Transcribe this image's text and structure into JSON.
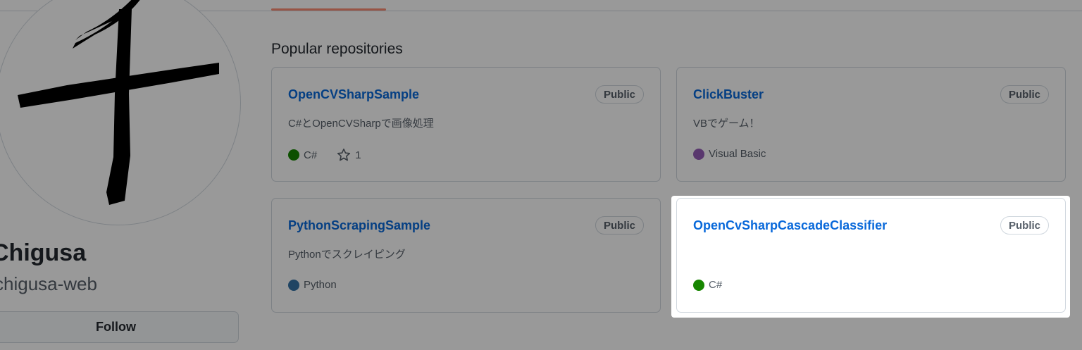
{
  "profile": {
    "name": "Chigusa",
    "login": "chigusa-web",
    "follow_label": "Follow"
  },
  "section": {
    "title": "Popular repositories"
  },
  "repos": [
    {
      "name": "OpenCVSharpSample",
      "visibility": "Public",
      "description": "C#とOpenCVSharpで画像処理",
      "language": "C#",
      "language_color": "#178600",
      "stars": "1"
    },
    {
      "name": "ClickBuster",
      "visibility": "Public",
      "description": "VBでゲーム！",
      "language": "Visual Basic",
      "language_color": "#945db7"
    },
    {
      "name": "PythonScrapingSample",
      "visibility": "Public",
      "description": "Pythonでスクレイピング",
      "language": "Python",
      "language_color": "#3572A5"
    },
    {
      "name": "OpenCvSharpCascadeClassifier",
      "visibility": "Public",
      "description": "",
      "language": "C#",
      "language_color": "#178600"
    }
  ],
  "icons": {
    "star": "star-icon",
    "avatar": "kanji-chi-avatar"
  },
  "colors": {
    "link": "#0969da",
    "tab_underline": "#fd8c73",
    "highlight_background": "#ffffff"
  }
}
